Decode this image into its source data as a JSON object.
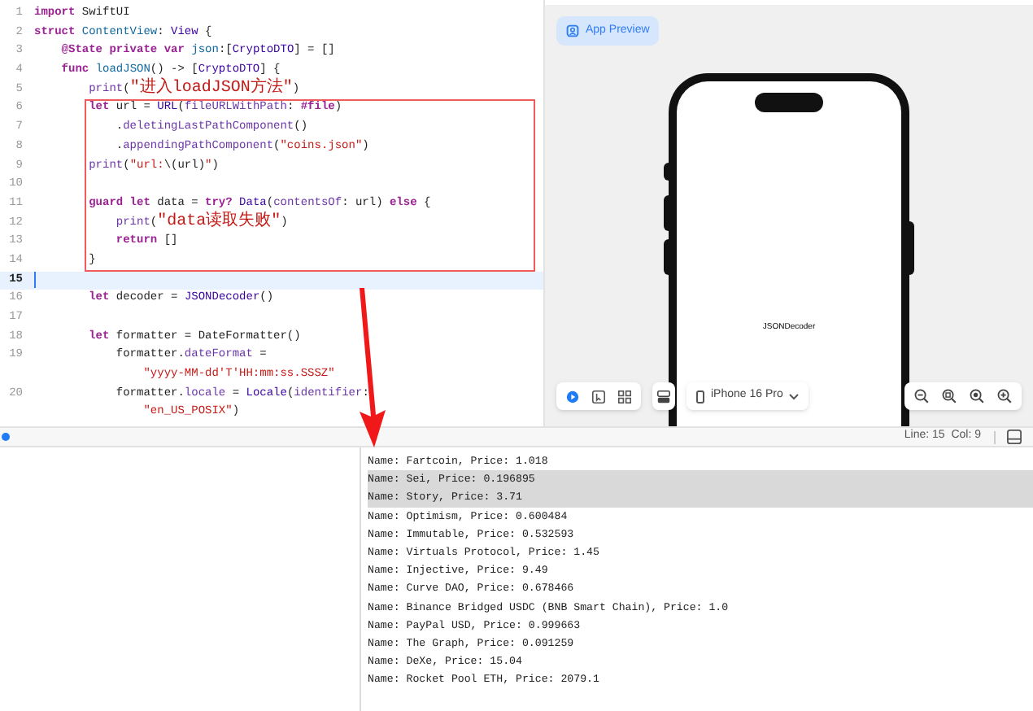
{
  "editor": {
    "lines": [
      {
        "number": "1",
        "segments": [
          {
            "kind": "kw",
            "text": "import"
          },
          {
            "kind": "plain",
            "text": " SwiftUI"
          }
        ]
      },
      {
        "number": "2",
        "segments": [
          {
            "kind": "kw",
            "text": "struct "
          },
          {
            "kind": "decl",
            "text": "ContentView"
          },
          {
            "kind": "plain",
            "text": ": "
          },
          {
            "kind": "type",
            "text": "View"
          },
          {
            "kind": "plain",
            "text": " {"
          }
        ]
      },
      {
        "number": "3",
        "segments": [
          {
            "kind": "kw",
            "text": "    @State private var "
          },
          {
            "kind": "decl",
            "text": "json"
          },
          {
            "kind": "plain",
            "text": ":["
          },
          {
            "kind": "type",
            "text": "CryptoDTO"
          },
          {
            "kind": "plain",
            "text": "] = []"
          }
        ]
      },
      {
        "number": "4",
        "segments": [
          {
            "kind": "kw",
            "text": "    func "
          },
          {
            "kind": "decl",
            "text": "loadJSON"
          },
          {
            "kind": "plain",
            "text": "() -> ["
          },
          {
            "kind": "type",
            "text": "CryptoDTO"
          },
          {
            "kind": "plain",
            "text": "] {"
          }
        ]
      },
      {
        "number": "5",
        "segments": [
          {
            "kind": "member",
            "text": "        print"
          },
          {
            "kind": "plain",
            "text": "("
          },
          {
            "kind": "str_cjk",
            "text": "\"进入loadJSON方法\""
          },
          {
            "kind": "plain",
            "text": ")"
          }
        ]
      },
      {
        "number": "6",
        "boxed": true,
        "segments": [
          {
            "kind": "kw",
            "text": "        let"
          },
          {
            "kind": "plain",
            "text": " url = "
          },
          {
            "kind": "type",
            "text": "URL"
          },
          {
            "kind": "plain",
            "text": "("
          },
          {
            "kind": "member",
            "text": "fileURLWithPath"
          },
          {
            "kind": "plain",
            "text": ": "
          },
          {
            "kind": "kw",
            "text": "#file"
          },
          {
            "kind": "plain",
            "text": ")"
          }
        ]
      },
      {
        "number": "7",
        "boxed": true,
        "segments": [
          {
            "kind": "plain",
            "text": "            ."
          },
          {
            "kind": "member",
            "text": "deletingLastPathComponent"
          },
          {
            "kind": "plain",
            "text": "()"
          }
        ]
      },
      {
        "number": "8",
        "boxed": true,
        "segments": [
          {
            "kind": "plain",
            "text": "            ."
          },
          {
            "kind": "member",
            "text": "appendingPathComponent"
          },
          {
            "kind": "plain",
            "text": "("
          },
          {
            "kind": "str",
            "text": "\"coins.json\""
          },
          {
            "kind": "plain",
            "text": ")"
          }
        ]
      },
      {
        "number": "9",
        "boxed": true,
        "segments": [
          {
            "kind": "member",
            "text": "        print"
          },
          {
            "kind": "plain",
            "text": "("
          },
          {
            "kind": "str",
            "text": "\"url:"
          },
          {
            "kind": "plain",
            "text": "\\(url)"
          },
          {
            "kind": "str",
            "text": "\""
          },
          {
            "kind": "plain",
            "text": ")"
          }
        ]
      },
      {
        "number": "10",
        "boxed": true
      },
      {
        "number": "11",
        "boxed": true,
        "segments": [
          {
            "kind": "kw",
            "text": "        guard let"
          },
          {
            "kind": "plain",
            "text": " data = "
          },
          {
            "kind": "kw",
            "text": "try? "
          },
          {
            "kind": "type",
            "text": "Data"
          },
          {
            "kind": "plain",
            "text": "("
          },
          {
            "kind": "member",
            "text": "contentsOf"
          },
          {
            "kind": "plain",
            "text": ": url) "
          },
          {
            "kind": "kw",
            "text": "else"
          },
          {
            "kind": "plain",
            "text": " {"
          }
        ]
      },
      {
        "number": "12",
        "boxed": true,
        "segments": [
          {
            "kind": "member",
            "text": "            print"
          },
          {
            "kind": "plain",
            "text": "("
          },
          {
            "kind": "str_cjk",
            "text": "\"data读取失败\""
          },
          {
            "kind": "plain",
            "text": ")"
          }
        ]
      },
      {
        "number": "13",
        "boxed": true,
        "segments": [
          {
            "kind": "kw",
            "text": "            return"
          },
          {
            "kind": "plain",
            "text": " []"
          }
        ]
      },
      {
        "number": "14",
        "boxed": true,
        "segments": [
          {
            "kind": "plain",
            "text": "        }"
          }
        ]
      },
      {
        "number": "15",
        "current": true
      },
      {
        "number": "16",
        "current": false,
        "segments": [
          {
            "kind": "kw",
            "text": "        let"
          },
          {
            "kind": "plain",
            "text": " decoder = "
          },
          {
            "kind": "type",
            "text": "JSONDecoder"
          },
          {
            "kind": "plain",
            "text": "()"
          }
        ]
      },
      {
        "number": "17"
      },
      {
        "number": "18",
        "segments": [
          {
            "kind": "kw",
            "text": "        let"
          },
          {
            "kind": "plain",
            "text": " formatter = DateFormatter()"
          }
        ]
      },
      {
        "number": "19",
        "segments": [
          {
            "kind": "plain",
            "text": "            formatter."
          },
          {
            "kind": "member",
            "text": "dateFormat"
          },
          {
            "kind": "plain",
            "text": " ="
          }
        ],
        "wrap": [
          {
            "kind": "str",
            "text": "                \"yyyy-MM-dd'T'HH:mm:ss.SSSZ\""
          }
        ]
      },
      {
        "number": "20",
        "segments": [
          {
            "kind": "plain",
            "text": "            formatter."
          },
          {
            "kind": "member",
            "text": "locale"
          },
          {
            "kind": "plain",
            "text": " = "
          },
          {
            "kind": "type",
            "text": "Locale"
          },
          {
            "kind": "plain",
            "text": "("
          },
          {
            "kind": "member",
            "text": "identifier"
          },
          {
            "kind": "plain",
            "text": ":"
          }
        ],
        "wrap": [
          {
            "kind": "str",
            "text": "                \"en_US_POSIX\""
          },
          {
            "kind": "plain",
            "text": ")"
          }
        ]
      }
    ]
  },
  "preview": {
    "tab": "App Preview",
    "screen_text": "JSONDecoder",
    "mode_buttons": [
      {
        "selected": true
      },
      {
        "selected": false
      },
      {
        "selected": false
      }
    ],
    "device": "iPhone 16 Pro"
  },
  "status_bar": {
    "position": "Line: 15  Col: 9"
  },
  "console": {
    "lines": [
      {
        "text": "Name: Fartcoin, Price: 1.018",
        "selected": false
      },
      {
        "text": "Name: Sei, Price: 0.196895",
        "selected": true
      },
      {
        "text": "Name: Story, Price: 3.71",
        "selected": true
      },
      {
        "text": "Name: Optimism, Price: 0.600484",
        "selected": false
      },
      {
        "text": "Name: Immutable, Price: 0.532593",
        "selected": false
      },
      {
        "text": "Name: Virtuals Protocol, Price: 1.45",
        "selected": false
      },
      {
        "text": "Name: Injective, Price: 9.49",
        "selected": false
      },
      {
        "text": "Name: Curve DAO, Price: 0.678466",
        "selected": false
      },
      {
        "text": "Name: Binance Bridged USDC (BNB Smart Chain), Price: 1.0",
        "selected": false
      },
      {
        "text": "Name: PayPal USD, Price: 0.999663",
        "selected": false
      },
      {
        "text": "Name: The Graph, Price: 0.091259",
        "selected": false
      },
      {
        "text": "Name: DeXe, Price: 15.04",
        "selected": false
      },
      {
        "text": "Name: Rocket Pool ETH, Price: 2079.1",
        "selected": false
      }
    ]
  }
}
